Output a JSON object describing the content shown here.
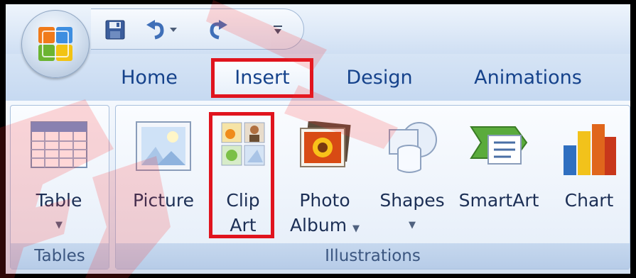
{
  "tabs": [
    {
      "id": "home",
      "label": "Home"
    },
    {
      "id": "insert",
      "label": "Insert"
    },
    {
      "id": "design",
      "label": "Design"
    },
    {
      "id": "animations",
      "label": "Animations"
    }
  ],
  "groups": {
    "tables": {
      "label": "Tables",
      "commands": [
        {
          "id": "table",
          "label": "Table",
          "has_dropdown": true
        }
      ]
    },
    "illustrations": {
      "label": "Illustrations",
      "commands": [
        {
          "id": "picture",
          "label": "Picture"
        },
        {
          "id": "clip_art",
          "label_line1": "Clip",
          "label_line2": "Art"
        },
        {
          "id": "photo_album",
          "label_line1": "Photo",
          "label_line2": "Album",
          "has_dropdown": true
        },
        {
          "id": "shapes",
          "label": "Shapes",
          "has_dropdown": true
        },
        {
          "id": "smartart",
          "label": "SmartArt"
        },
        {
          "id": "chart",
          "label": "Chart"
        }
      ]
    }
  },
  "highlight_color": "#e0141e",
  "quick_access_icons": [
    "save-icon",
    "undo-icon",
    "undo-dropdown-icon",
    "redo-icon",
    "customize-toolbar-icon"
  ]
}
